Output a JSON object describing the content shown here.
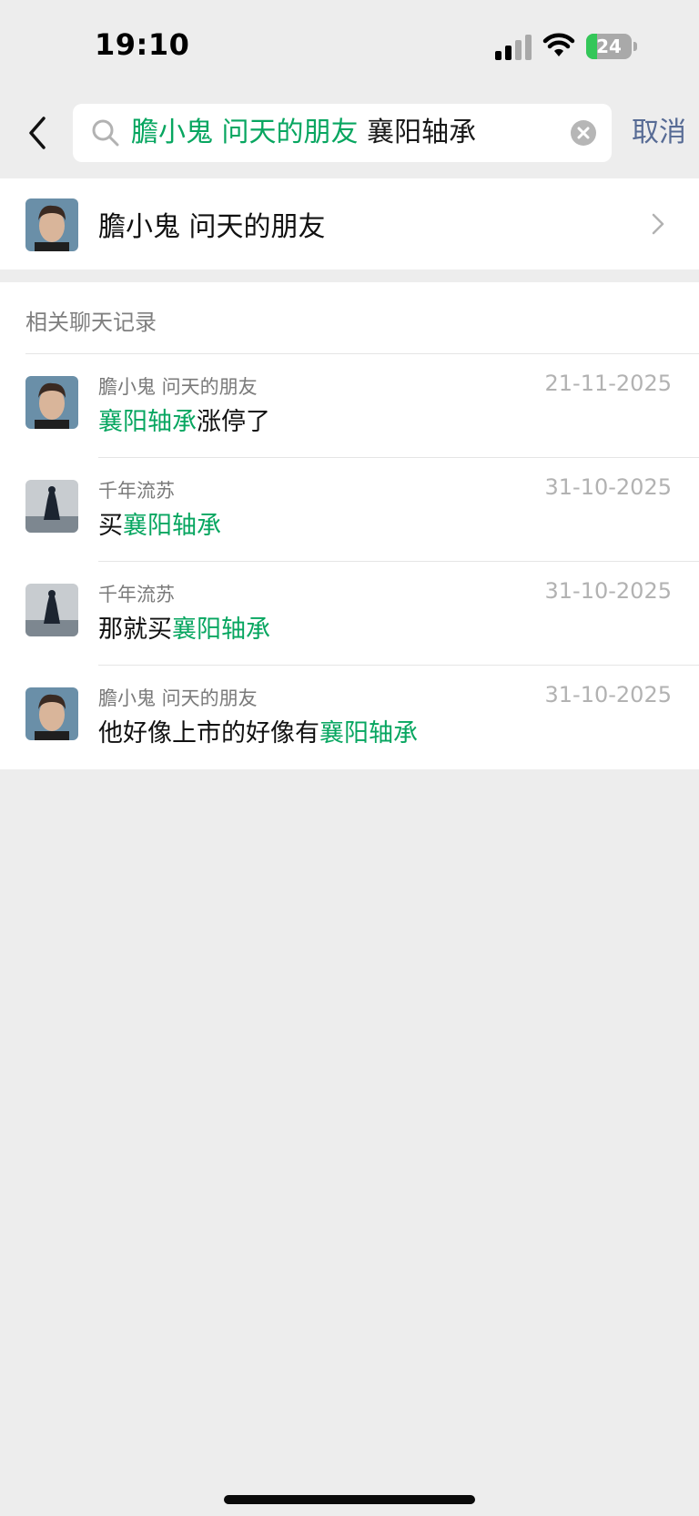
{
  "status_bar": {
    "time": "19:10",
    "battery_level": "24",
    "battery_charging": true,
    "icons": [
      "signal-icon",
      "wifi-icon",
      "battery-icon"
    ]
  },
  "search": {
    "query_highlighted": "膽小鬼 问天的朋友",
    "query_rest": " 襄阳轴承",
    "cancel_label": "取消"
  },
  "contact": {
    "name": "膽小鬼 问天的朋友"
  },
  "records": {
    "section_title": "相关聊天记录",
    "items": [
      {
        "sender": "膽小鬼 问天的朋友",
        "date": "21-11-2025",
        "before": "",
        "highlight": "襄阳轴承",
        "after": "涨停了",
        "avatar": "face"
      },
      {
        "sender": "千年流苏",
        "date": "31-10-2025",
        "before": "买",
        "highlight": "襄阳轴承",
        "after": "",
        "avatar": "figure"
      },
      {
        "sender": "千年流苏",
        "date": "31-10-2025",
        "before": "那就买",
        "highlight": "襄阳轴承",
        "after": "",
        "avatar": "figure"
      },
      {
        "sender": "膽小鬼 问天的朋友",
        "date": "31-10-2025",
        "before": "他好像上市的好像有",
        "highlight": "襄阳轴承",
        "after": "",
        "avatar": "face"
      }
    ]
  },
  "colors": {
    "highlight": "#07a660",
    "link": "#576b95",
    "background": "#ededed"
  }
}
